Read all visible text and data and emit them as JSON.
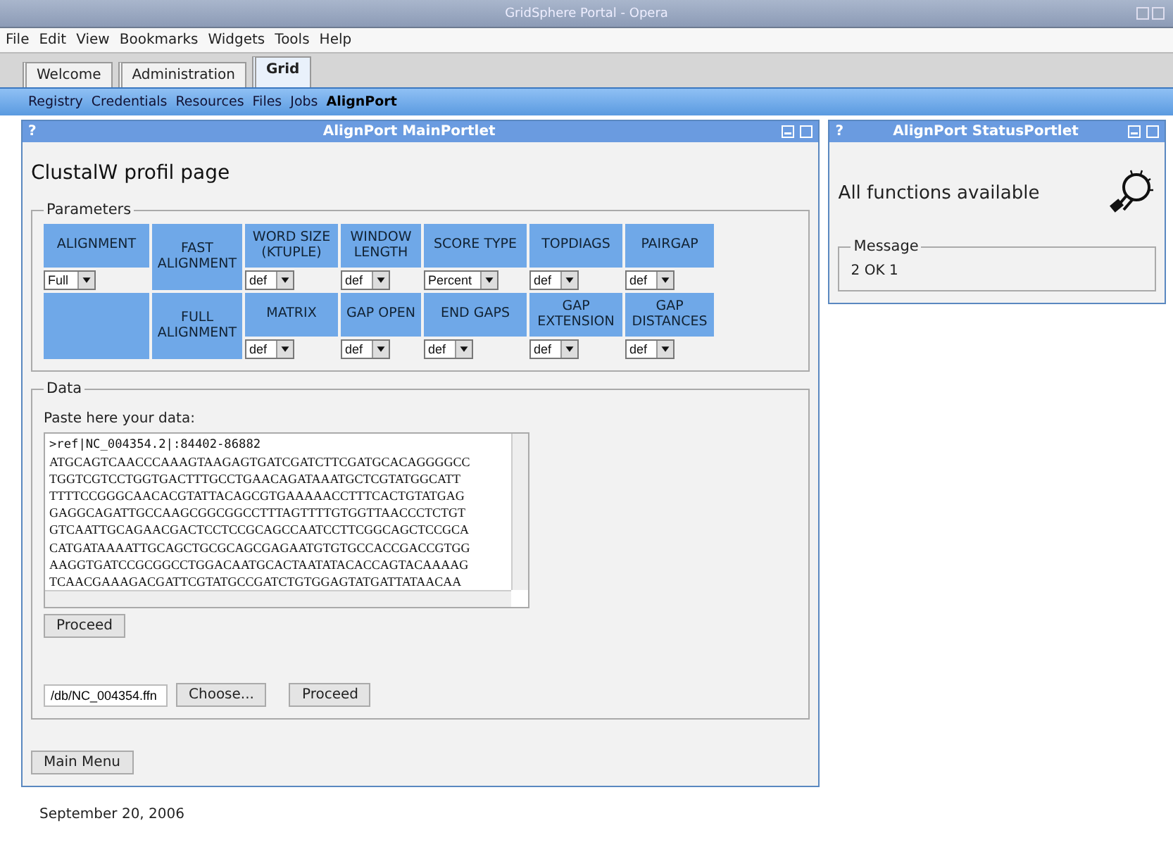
{
  "window": {
    "title": "GridSphere Portal - Opera"
  },
  "menu": [
    "File",
    "Edit",
    "View",
    "Bookmarks",
    "Widgets",
    "Tools",
    "Help"
  ],
  "tabs": [
    {
      "label": "Welcome",
      "selected": false
    },
    {
      "label": "Administration",
      "selected": false
    },
    {
      "label": "Grid",
      "selected": true
    }
  ],
  "subnav": [
    {
      "label": "Registry",
      "selected": false
    },
    {
      "label": "Credentials",
      "selected": false
    },
    {
      "label": "Resources",
      "selected": false
    },
    {
      "label": "Files",
      "selected": false
    },
    {
      "label": "Jobs",
      "selected": false
    },
    {
      "label": "AlignPort",
      "selected": true
    }
  ],
  "main_portlet": {
    "help": "?",
    "title": "AlignPort MainPortlet",
    "heading": "ClustalW profil page",
    "parameters": {
      "legend": "Parameters",
      "rows": [
        [
          {
            "label": "ALIGNMENT",
            "value": "Full"
          },
          {
            "label": "FAST ALIGNMENT"
          },
          {
            "label": "WORD SIZE (KTUPLE)",
            "value": "def"
          },
          {
            "label": "WINDOW LENGTH",
            "value": "def"
          },
          {
            "label": "SCORE TYPE",
            "value": "Percent"
          },
          {
            "label": "TOPDIAGS",
            "value": "def"
          },
          {
            "label": "PAIRGAP",
            "value": "def"
          }
        ],
        [
          {},
          {
            "label": "FULL ALIGNMENT"
          },
          {
            "label": "MATRIX",
            "value": "def"
          },
          {
            "label": "GAP OPEN",
            "value": "def"
          },
          {
            "label": "END GAPS",
            "value": "def"
          },
          {
            "label": "GAP EXTENSION",
            "value": "def"
          },
          {
            "label": "GAP DISTANCES",
            "value": "def"
          }
        ]
      ]
    },
    "data": {
      "legend": "Data",
      "prompt": "Paste here your data:",
      "lines": [
        ">ref|NC_004354.2|:84402-86882",
        "ATGCAGTCAACCCAAAGTAAGAGTGATCGATCTTCGATGCACAGGGGCC",
        "TGGTCGTCCTGGTGACTTTGCCTGAACAGATAAATGCTCGTATGGCATT",
        "TTTTCCGGGCAACACGTATTACAGCGTGAAAAACCTTTCACTGTATGAG",
        "GAGGCAGATTGCCAAGCGGCGGCCTTTAGTTTTGTGGTTAACCCTCTGT",
        "GTCAATTGCAGAACGACTCCTCCGCAGCCAATCCTTCGGCAGCTCCGCA",
        "CATGATAAAATTGCAGCTGCGCAGCGAGAATGTGTGCCACCGACCGTGG",
        "AAGGTGATCCGCGGCCTGGACAATGCACTAATATACACCAGTACAAAAG",
        "TCAACGAAAGACGATTCGTATGCCGATCTGTGGAGTATGATTATAACAA"
      ],
      "proceed": "Proceed",
      "file": "/db/NC_004354.ffn",
      "choose": "Choose...",
      "proceed2": "Proceed"
    },
    "main_menu": "Main Menu"
  },
  "status_portlet": {
    "help": "?",
    "title": "AlignPort StatusPortlet",
    "status": "All functions available",
    "message_legend": "Message",
    "message": "2 OK 1"
  },
  "footer": "September 20, 2006"
}
